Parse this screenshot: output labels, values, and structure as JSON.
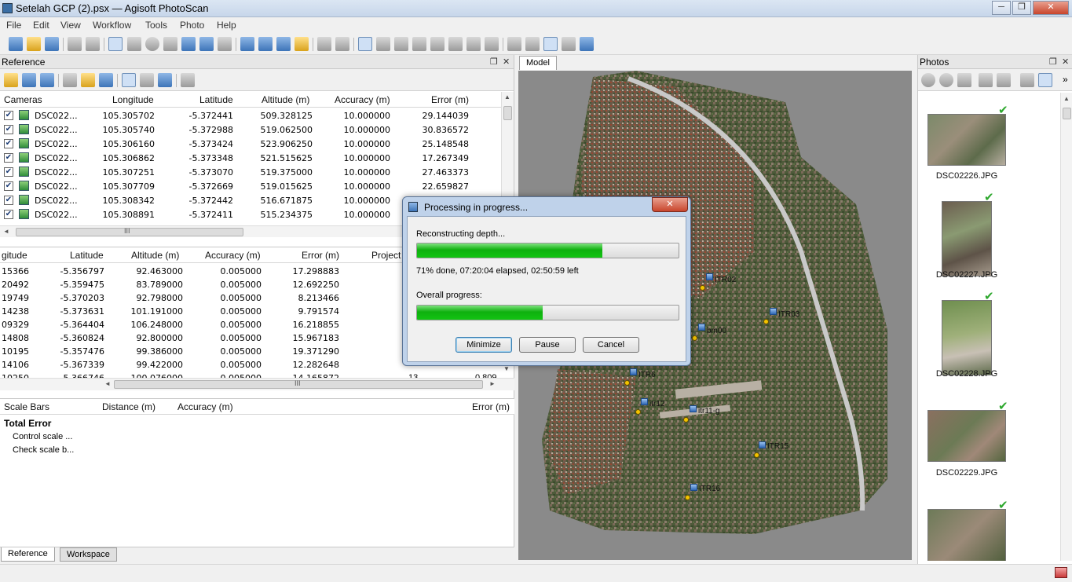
{
  "window": {
    "title": "Setelah GCP (2).psx — Agisoft PhotoScan",
    "min": "─",
    "max": "❐",
    "close": "✕"
  },
  "menu": [
    "File",
    "Edit",
    "View",
    "Workflow",
    "Tools",
    "Photo",
    "Help"
  ],
  "reference": {
    "title": "Reference",
    "cameras": {
      "headers": [
        "Cameras",
        "Longitude",
        "Latitude",
        "Altitude (m)",
        "Accuracy (m)",
        "Error (m)"
      ],
      "rows": [
        [
          "DSC022...",
          "105.305702",
          "-5.372441",
          "509.328125",
          "10.000000",
          "29.144039"
        ],
        [
          "DSC022...",
          "105.305740",
          "-5.372988",
          "519.062500",
          "10.000000",
          "30.836572"
        ],
        [
          "DSC022...",
          "105.306160",
          "-5.373424",
          "523.906250",
          "10.000000",
          "25.148548"
        ],
        [
          "DSC022...",
          "105.306862",
          "-5.373348",
          "521.515625",
          "10.000000",
          "17.267349"
        ],
        [
          "DSC022...",
          "105.307251",
          "-5.373070",
          "519.375000",
          "10.000000",
          "27.463373"
        ],
        [
          "DSC022...",
          "105.307709",
          "-5.372669",
          "519.015625",
          "10.000000",
          "22.659827"
        ],
        [
          "DSC022...",
          "105.308342",
          "-5.372442",
          "516.671875",
          "10.000000",
          ""
        ],
        [
          "DSC022...",
          "105.308891",
          "-5.372411",
          "515.234375",
          "10.000000",
          ""
        ]
      ]
    },
    "markers": {
      "headers": [
        "gitude",
        "Latitude",
        "Altitude (m)",
        "Accuracy (m)",
        "Error (m)",
        "Project"
      ],
      "rows": [
        [
          "15366",
          "-5.356797",
          "92.463000",
          "0.005000",
          "17.298883"
        ],
        [
          "20492",
          "-5.359475",
          "83.789000",
          "0.005000",
          "12.692250"
        ],
        [
          "19749",
          "-5.370203",
          "92.798000",
          "0.005000",
          "8.213466"
        ],
        [
          "14238",
          "-5.373631",
          "101.191000",
          "0.005000",
          "9.791574"
        ],
        [
          "09329",
          "-5.364404",
          "106.248000",
          "0.005000",
          "16.218855"
        ],
        [
          "14808",
          "-5.360824",
          "92.800000",
          "0.005000",
          "15.967183"
        ],
        [
          "10195",
          "-5.357476",
          "99.386000",
          "0.005000",
          "19.371290"
        ],
        [
          "14106",
          "-5.367339",
          "99.422000",
          "0.005000",
          "12.282648"
        ],
        [
          "10250",
          "-5.366746",
          "100.076000",
          "0.005000",
          "14.165872"
        ]
      ],
      "last_row_extra": [
        "13",
        "0.809"
      ]
    },
    "scalebars": {
      "headers": [
        "Scale Bars",
        "Distance (m)",
        "Accuracy (m)",
        "Error (m)"
      ],
      "total_error": "Total Error",
      "control": "Control scale ...",
      "check": "Check scale b..."
    },
    "tabs": [
      "Reference",
      "Workspace"
    ]
  },
  "model": {
    "tab": "Model",
    "markers": [
      "ITR02",
      "ITR03",
      "bm00",
      "ITR6",
      "itr12",
      "itr11-g",
      "ITR15",
      "ITR16"
    ]
  },
  "dialog": {
    "title": "Processing in progress...",
    "close": "✕",
    "task": "Reconstructing depth...",
    "task_progress": 0.71,
    "status": "71% done, 07:20:04 elapsed, 02:50:59 left",
    "overall_label": "Overall progress:",
    "overall_progress": 0.48,
    "buttons": {
      "minimize": "Minimize",
      "pause": "Pause",
      "cancel": "Cancel"
    }
  },
  "photos": {
    "title": "Photos",
    "items": [
      "DSC02226.JPG",
      "DSC02227.JPG",
      "DSC02228.JPG",
      "DSC02229.JPG"
    ]
  },
  "panel_buttons": {
    "float": "❐",
    "close": "✕"
  },
  "scroll_arrows": {
    "up": "▲",
    "down": "▼",
    "left": "◄",
    "right": "►",
    "grip": "III",
    "more": "»"
  }
}
